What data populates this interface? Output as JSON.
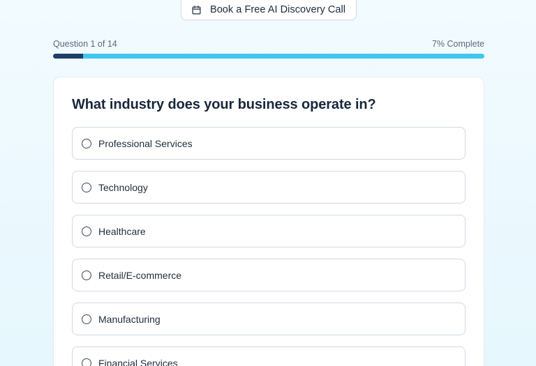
{
  "cta": {
    "label": "Book a Free AI Discovery Call",
    "icon": "calendar-icon"
  },
  "progress": {
    "question_text": "Question 1 of 14",
    "complete_text": "7% Complete",
    "percent": 7
  },
  "question": {
    "title": "What industry does your business operate in?",
    "options": [
      {
        "label": "Professional Services"
      },
      {
        "label": "Technology"
      },
      {
        "label": "Healthcare"
      },
      {
        "label": "Retail/E-commerce"
      },
      {
        "label": "Manufacturing"
      },
      {
        "label": "Financial Services"
      }
    ]
  },
  "colors": {
    "progress_fill": "#1e3f66",
    "progress_track": "#41c6ef",
    "background": "#eef9fe"
  }
}
